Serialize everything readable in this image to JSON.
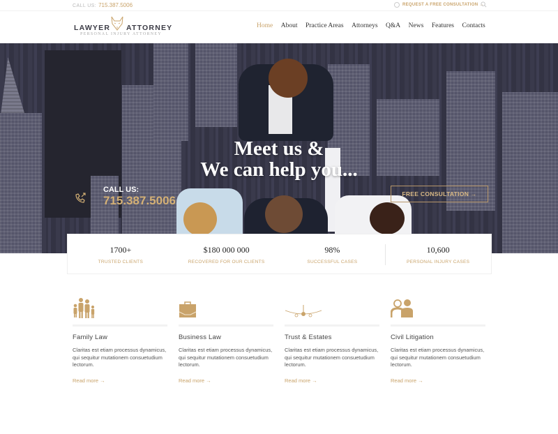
{
  "topbar": {
    "call_label": "CALL US:",
    "call_number": "715.387.5006",
    "request_label": "REQUEST A FREE CONSULTATION →"
  },
  "logo": {
    "word1": "LAWYER",
    "word2": "ATTORNEY",
    "tagline": "PERSONAL INJURY ATTORNEY"
  },
  "nav": {
    "items": [
      {
        "label": "Home",
        "active": true
      },
      {
        "label": "About"
      },
      {
        "label": "Practice Areas"
      },
      {
        "label": "Attorneys"
      },
      {
        "label": "Q&A"
      },
      {
        "label": "News"
      },
      {
        "label": "Features"
      },
      {
        "label": "Contacts"
      }
    ]
  },
  "hero": {
    "title_line1": "Meet us &",
    "title_line2": "We can help you...",
    "call_label": "CALL US:",
    "call_number": "715.387.5006",
    "consult_button": "FREE CONSULTATION →"
  },
  "stats": [
    {
      "value": "1700+",
      "label": "TRUSTED CLIENTS"
    },
    {
      "value": "$180 000 000",
      "label": "RECOVERED FOR OUR CLIENTS"
    },
    {
      "value": "98%",
      "label": "SUCCESSFUL CASES"
    },
    {
      "value": "10,600",
      "label": "PERSONAL INJURY CASES"
    }
  ],
  "services": [
    {
      "icon": "family-icon",
      "title": "Family Law",
      "text": "Claritas est etiam processus dynamicus, qui sequitur mutationem consuetudium lectorum.",
      "link": "Read more →"
    },
    {
      "icon": "briefcase-icon",
      "title": "Business Law",
      "text": "Claritas est etiam processus dynamicus, qui sequitur mutationem consuetudium lectorum.",
      "link": "Read more →"
    },
    {
      "icon": "airplane-icon",
      "title": "Trust & Estates",
      "text": "Claritas est etiam processus dynamicus, qui sequitur mutationem consuetudium lectorum.",
      "link": "Read more →"
    },
    {
      "icon": "users-icon",
      "title": "Civil Litigation",
      "text": "Claritas est etiam processus dynamicus, qui sequitur mutationem consuetudium lectorum.",
      "link": "Read more →"
    }
  ],
  "colors": {
    "accent": "#c9a36a",
    "hero_overlay": "#2d2d3e",
    "text_dark": "#333333"
  }
}
